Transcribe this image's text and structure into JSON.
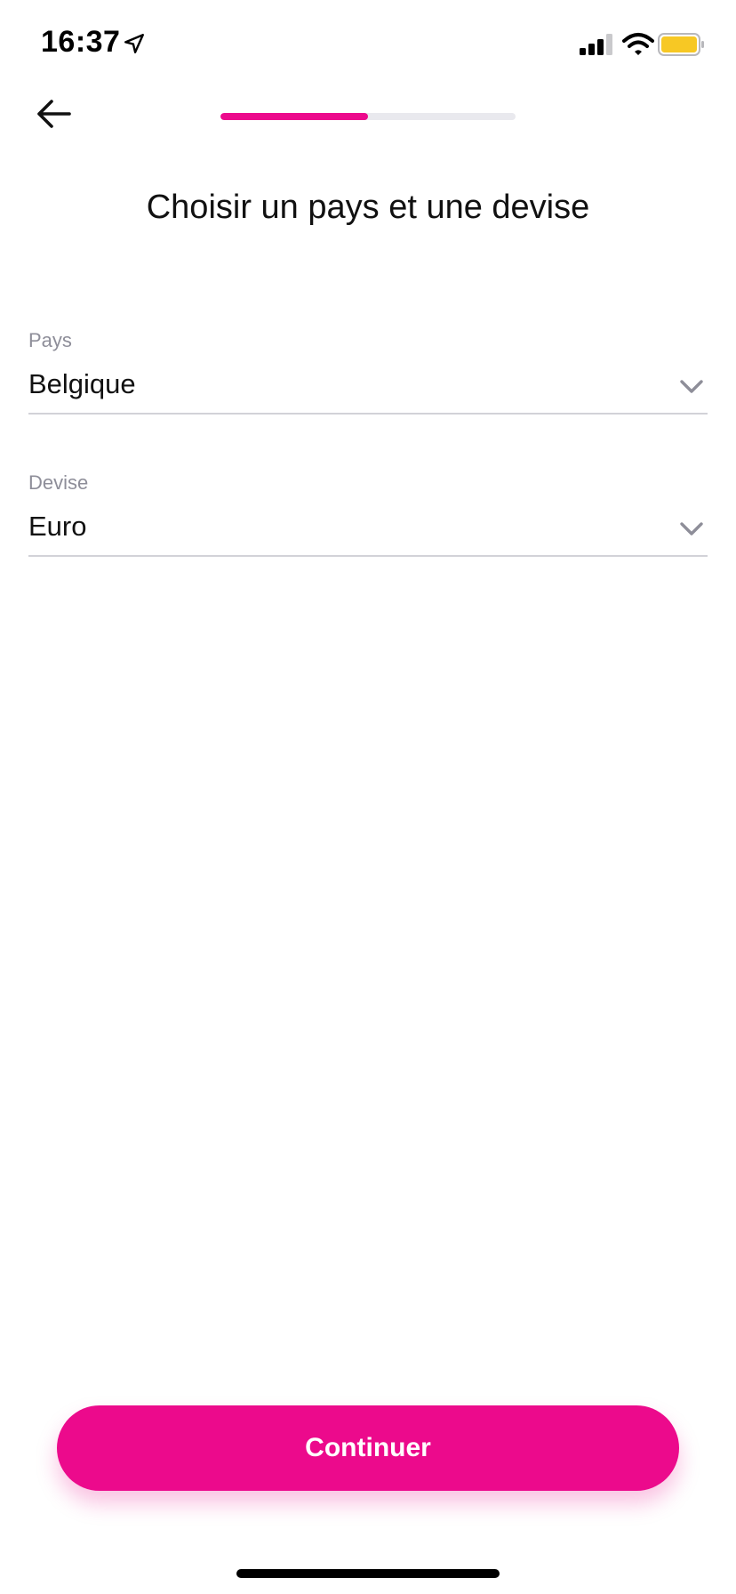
{
  "status_bar": {
    "time": "16:37",
    "icons": [
      "location-arrow-icon",
      "cellular-signal-icon",
      "wifi-icon",
      "battery-icon"
    ],
    "battery_color": "#f7c824"
  },
  "header": {
    "back_icon": "arrow-left-icon",
    "progress": 0.5
  },
  "title": "Choisir un pays et une devise",
  "fields": {
    "country": {
      "label": "Pays",
      "value": "Belgique",
      "icon": "chevron-down-icon"
    },
    "currency": {
      "label": "Devise",
      "value": "Euro",
      "icon": "chevron-down-icon"
    }
  },
  "continue_button": {
    "label": "Continuer"
  },
  "colors": {
    "accent": "#ec0a8c",
    "track": "#e9e9ee",
    "label": "#8e8e99",
    "divider": "#d2d2d8"
  }
}
